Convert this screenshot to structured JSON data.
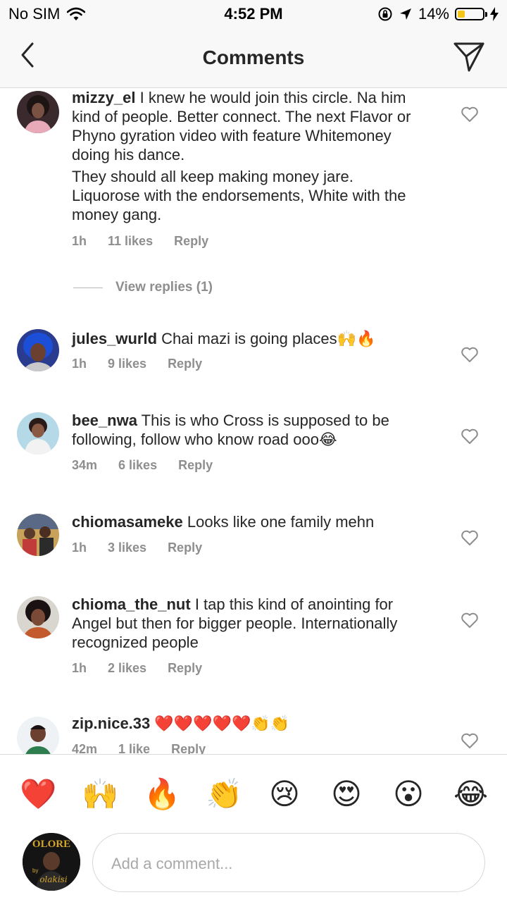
{
  "status_bar": {
    "carrier": "No SIM",
    "time": "4:52 PM",
    "battery": "14%",
    "battery_level": 0.14,
    "icons": [
      "wifi-icon",
      "orientation-lock-icon",
      "location-arrow-icon",
      "battery-icon",
      "charging-bolt-icon"
    ]
  },
  "header": {
    "title": "Comments",
    "back_icon": "chevron-left-icon",
    "send_icon": "paper-plane-icon"
  },
  "comments": [
    {
      "username": "mizzy_el",
      "text": "I knew he would join this circle. Na him kind of people. Better connect. The next Flavor or Phyno gyration video with feature Whitemoney doing his dance.",
      "text2": "They should all keep making money jare. Liquorose with the endorsements, White with the money gang.",
      "time": "1h",
      "likes": "11 likes",
      "reply": "Reply",
      "view_replies": "View replies (1)"
    },
    {
      "username": "jules_wurld",
      "text": "Chai mazi is going places🙌🔥",
      "time": "1h",
      "likes": "9 likes",
      "reply": "Reply"
    },
    {
      "username": "bee_nwa",
      "text": "This is who Cross is supposed to be following, follow who know road ooo😂",
      "time": "34m",
      "likes": "6 likes",
      "reply": "Reply"
    },
    {
      "username": "chiomasameke",
      "text": "Looks like one family mehn",
      "time": "1h",
      "likes": "3 likes",
      "reply": "Reply"
    },
    {
      "username": "chioma_the_nut",
      "text": "I tap this kind of anointing for Angel but then for bigger people. Internationally recognized people",
      "time": "1h",
      "likes": "2 likes",
      "reply": "Reply"
    },
    {
      "username": "zip.nice.33",
      "text": "❤️❤️❤️❤️❤️👏👏",
      "time": "42m",
      "likes": "1 like",
      "reply": "Reply"
    }
  ],
  "emoji_bar": [
    "❤️",
    "🙌",
    "🔥",
    "👏",
    "😢",
    "😍",
    "😮",
    "😂"
  ],
  "composer": {
    "placeholder": "Add a comment...",
    "avatar_text": "OLORE",
    "avatar_sub": "by",
    "avatar_script": "olakisi"
  },
  "colors": {
    "text": "#262626",
    "meta": "#8e8e8e",
    "bar_background": "#f8f8f8",
    "battery_fill": "#f5c518"
  }
}
